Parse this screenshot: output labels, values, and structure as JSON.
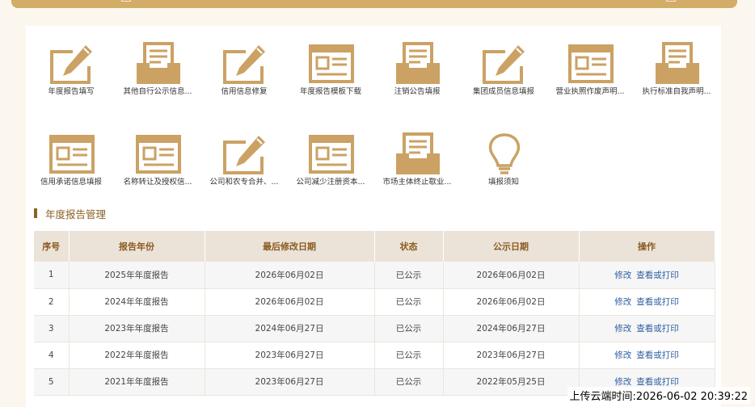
{
  "colors": {
    "accent": "#d3ac67",
    "header_text": "#8b5a1f",
    "link": "#2d5da1"
  },
  "tiles": [
    {
      "label": "年度报告填写",
      "icon": "pencil-edit-icon"
    },
    {
      "label": "其他自行公示信息...",
      "icon": "inbox-tray-icon"
    },
    {
      "label": "信用信息修复",
      "icon": "pencil-edit-icon"
    },
    {
      "label": "年度报告模板下载",
      "icon": "document-form-icon"
    },
    {
      "label": "注销公告填报",
      "icon": "inbox-tray-icon"
    },
    {
      "label": "集团成员信息填报",
      "icon": "pencil-edit-icon"
    },
    {
      "label": "营业执照作废声明...",
      "icon": "document-form-icon"
    },
    {
      "label": "执行标准自我声明...",
      "icon": "inbox-tray-icon"
    },
    {
      "label": "信用承诺信息填报",
      "icon": "document-form-icon"
    },
    {
      "label": "名称转让及授权信...",
      "icon": "document-form-icon"
    },
    {
      "label": "公司和农专合并、...",
      "icon": "pencil-edit-icon"
    },
    {
      "label": "公司减少注册资本...",
      "icon": "document-form-icon"
    },
    {
      "label": "市场主体终止歇业...",
      "icon": "inbox-tray-icon"
    },
    {
      "label": "填报须知",
      "icon": "lightbulb-icon"
    }
  ],
  "section_title": "年度报告管理",
  "table": {
    "headers": [
      "序号",
      "报告年份",
      "最后修改日期",
      "状态",
      "公示日期",
      "操作"
    ],
    "action_edit": "修改",
    "action_view": "查看或打印",
    "rows": [
      [
        "1",
        "2025年年度报告",
        "2026年06月02日",
        "已公示",
        "2026年06月02日"
      ],
      [
        "2",
        "2024年年度报告",
        "2026年06月02日",
        "已公示",
        "2026年06月02日"
      ],
      [
        "3",
        "2023年年度报告",
        "2024年06月27日",
        "已公示",
        "2024年06月27日"
      ],
      [
        "4",
        "2022年年度报告",
        "2023年06月27日",
        "已公示",
        "2023年06月27日"
      ],
      [
        "5",
        "2021年年度报告",
        "2023年06月27日",
        "已公示",
        "2022年05月25日"
      ]
    ]
  },
  "upload_timestamp": "上传云端时间:2026-06-02 20:39:22"
}
